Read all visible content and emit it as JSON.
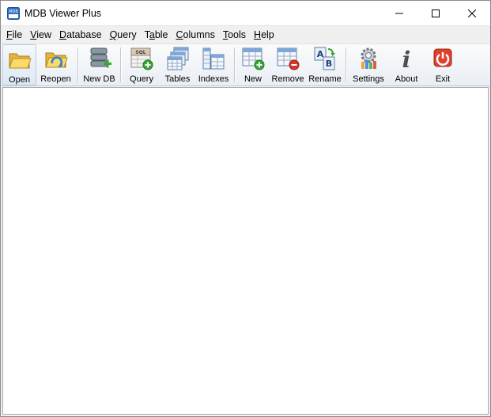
{
  "window": {
    "title": "MDB Viewer Plus",
    "icon_text": "MDB"
  },
  "menu": [
    {
      "key": "F",
      "rest": "ile"
    },
    {
      "key": "V",
      "rest": "iew"
    },
    {
      "key": "D",
      "rest": "atabase"
    },
    {
      "key": "Q",
      "rest": "uery"
    },
    {
      "pre": "T",
      "key": "a",
      "rest": "ble"
    },
    {
      "key": "C",
      "rest": "olumns"
    },
    {
      "key": "T",
      "rest": "ools"
    },
    {
      "key": "H",
      "rest": "elp"
    }
  ],
  "toolbar": {
    "open": "Open",
    "reopen": "Reopen",
    "new_db": "New DB",
    "query": "Query",
    "tables": "Tables",
    "indexes": "Indexes",
    "new": "New",
    "remove": "Remove",
    "rename": "Rename",
    "settings": "Settings",
    "about": "About",
    "exit": "Exit"
  },
  "icons": {
    "sql_badge": "SQL",
    "about_glyph": "i",
    "rename_a": "A",
    "rename_b": "B"
  },
  "colors": {
    "accent_green": "#3aa635",
    "remove_red": "#d9362b",
    "exit_red": "#e0402c",
    "folder_yellow": "#f4cc48"
  }
}
